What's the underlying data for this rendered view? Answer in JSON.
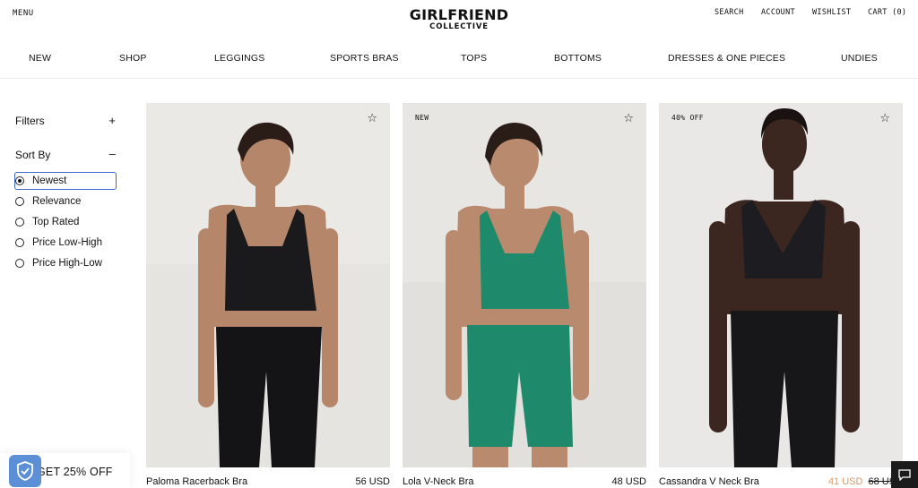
{
  "header": {
    "menu_label": "MENU",
    "logo_main": "GIRLFRIEND",
    "logo_sub": "COLLECTIVE",
    "search_label": "SEARCH",
    "account_label": "ACCOUNT",
    "wishlist_label": "WISHLIST",
    "cart_label": "CART (0)"
  },
  "categories": [
    "NEW",
    "SHOP",
    "LEGGINGS",
    "SPORTS BRAS",
    "TOPS",
    "BOTTOMS",
    "DRESSES & ONE PIECES",
    "UNDIES"
  ],
  "sidebar": {
    "filters_label": "Filters",
    "filters_toggle": "+",
    "sort_label": "Sort By",
    "sort_toggle": "–",
    "sort_options": [
      "Newest",
      "Relevance",
      "Top Rated",
      "Price Low-High",
      "Price High-Low"
    ],
    "selected_sort": "Newest"
  },
  "products": [
    {
      "name": "Paloma Racerback Bra",
      "price": "56 USD",
      "badge": "",
      "top_color": "#1a1a1d",
      "bottom_color": "#141416"
    },
    {
      "name": "Lola V-Neck Bra",
      "price": "48 USD",
      "badge": "NEW",
      "top_color": "#1f8a6b",
      "bottom_color": "#1f8a6b"
    },
    {
      "name": "Cassandra V Neck Bra",
      "price_sale": "41 USD",
      "price_original": "68 USD",
      "badge": "40% OFF",
      "top_color": "#1d1d21",
      "bottom_color": "#17171a"
    }
  ],
  "promo": {
    "text": "GET 25% OFF"
  },
  "icons": {
    "star": "star-outline-icon",
    "shield": "shield-check-icon",
    "chat": "chat-icon"
  },
  "colors": {
    "accent_blue": "#5c8fd6",
    "sale_price": "#d99a6c",
    "focus_outline": "#3a67c9"
  }
}
